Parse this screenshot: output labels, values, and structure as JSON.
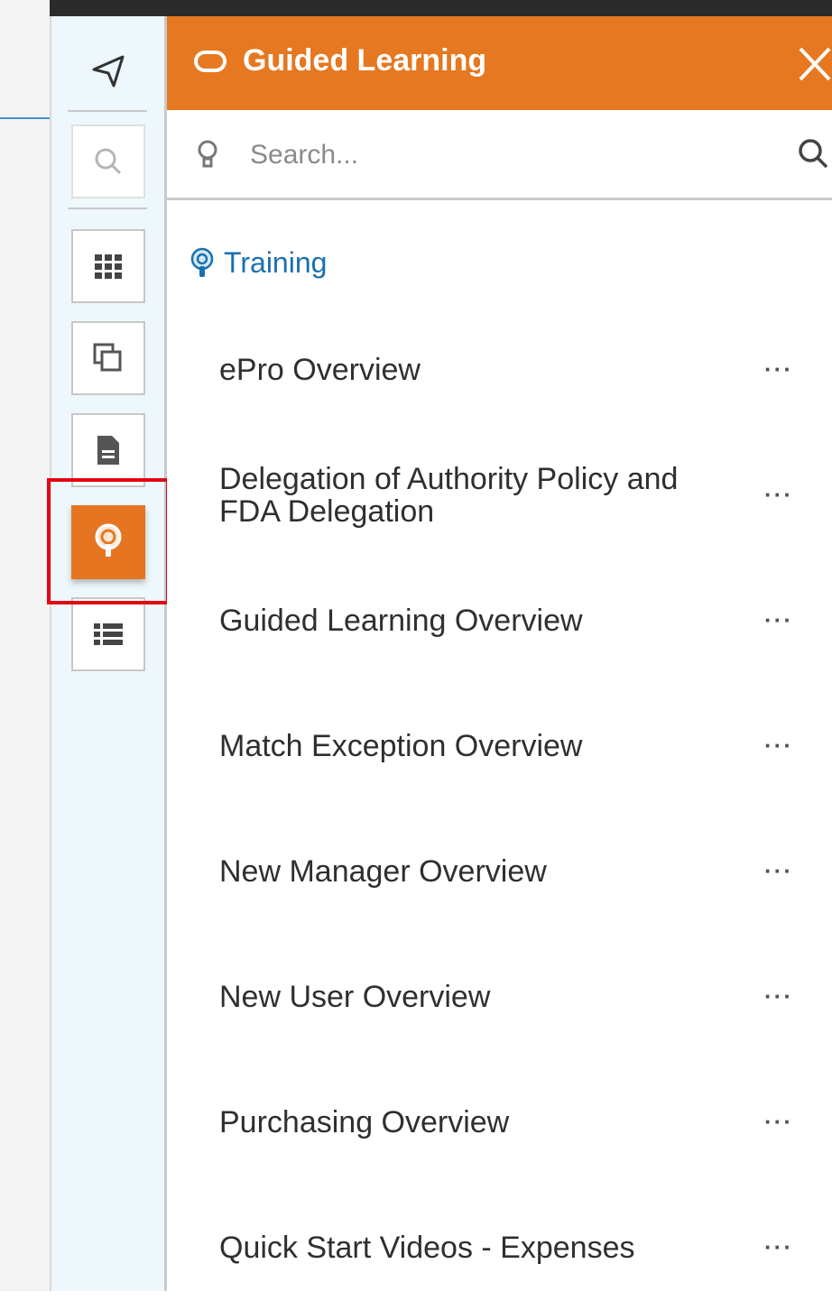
{
  "panel": {
    "title": "Guided Learning",
    "close_label": "✕",
    "search_placeholder": "Search..."
  },
  "section": {
    "label": "Training"
  },
  "items": [
    {
      "label": "ePro Overview",
      "more": "···"
    },
    {
      "label": "Delegation of Authority Policy and FDA Delegation",
      "more": "···"
    },
    {
      "label": "Guided Learning Overview",
      "more": "···"
    },
    {
      "label": "Match Exception Overview",
      "more": "···"
    },
    {
      "label": "New Manager Overview",
      "more": "···"
    },
    {
      "label": "New User Overview",
      "more": "···"
    },
    {
      "label": "Purchasing Overview",
      "more": "···"
    },
    {
      "label": "Quick Start Videos - Expenses",
      "more": "···"
    }
  ],
  "colors": {
    "accent": "#e57820",
    "link": "#1b6fb0",
    "highlight": "#e30613"
  },
  "rail_icons": [
    "navigate-icon",
    "search-icon",
    "grid-icon",
    "copy-icon",
    "document-icon",
    "guided-learning-icon",
    "list-icon"
  ]
}
